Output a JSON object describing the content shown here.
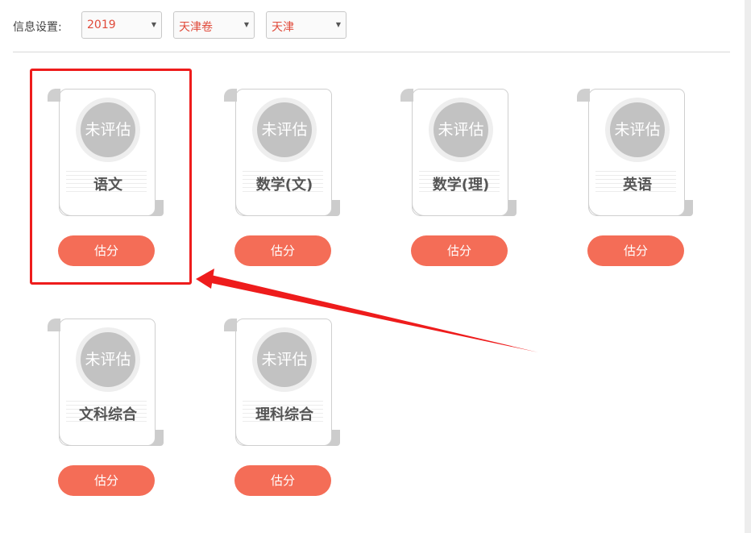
{
  "filter": {
    "label": "信息设置:",
    "year": "2019",
    "paper": "天津卷",
    "region": "天津"
  },
  "subjects": [
    {
      "status": "未评估",
      "name": "语文",
      "button": "估分"
    },
    {
      "status": "未评估",
      "name": "数学(文)",
      "button": "估分"
    },
    {
      "status": "未评估",
      "name": "数学(理)",
      "button": "估分"
    },
    {
      "status": "未评估",
      "name": "英语",
      "button": "估分"
    },
    {
      "status": "未评估",
      "name": "文科综合",
      "button": "估分"
    },
    {
      "status": "未评估",
      "name": "理科综合",
      "button": "估分"
    }
  ],
  "colors": {
    "accent": "#f46d57",
    "highlight": "#ee1c1c",
    "seal": "#c2c2c2"
  }
}
